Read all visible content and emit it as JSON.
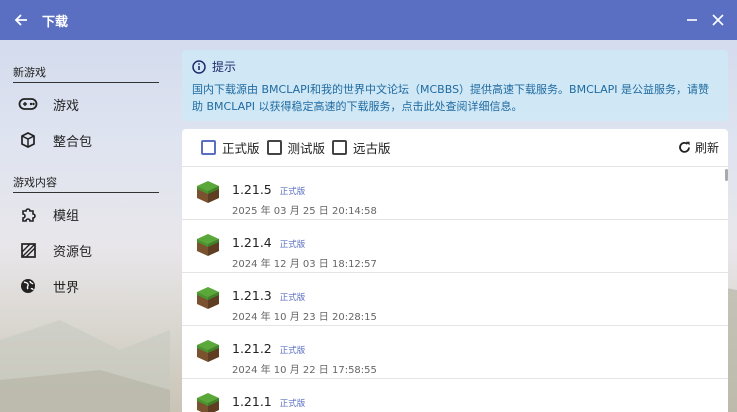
{
  "window": {
    "title": "下载",
    "back_icon": "back-arrow-icon",
    "minimize_icon": "minimize-icon",
    "close_icon": "close-icon"
  },
  "sidebar": {
    "sections": [
      {
        "heading": "新游戏",
        "items": [
          {
            "label": "游戏",
            "icon": "gamepad-icon"
          },
          {
            "label": "整合包",
            "icon": "package-icon"
          }
        ]
      },
      {
        "heading": "游戏内容",
        "items": [
          {
            "label": "模组",
            "icon": "puzzle-icon"
          },
          {
            "label": "资源包",
            "icon": "texture-icon"
          },
          {
            "label": "世界",
            "icon": "globe-icon"
          }
        ]
      }
    ]
  },
  "hint": {
    "icon": "info-icon",
    "title": "提示",
    "text": "国内下载源由 BMCLAPI和我的世界中文论坛（MCBBS）提供高速下载服务。BMCLAPI 是公益服务，请赞助 BMCLAPI 以获得稳定高速的下载服务，点击此处查阅详细信息。"
  },
  "filters": {
    "options": [
      {
        "label": "正式版",
        "checked": false
      },
      {
        "label": "测试版",
        "checked": false
      },
      {
        "label": "远古版",
        "checked": false
      }
    ],
    "refresh_label": "刷新",
    "refresh_icon": "refresh-icon"
  },
  "versions": [
    {
      "version": "1.21.5",
      "type": "正式版",
      "date": "2025 年 03 月 25 日 20:14:58",
      "icon": "grass-block-icon"
    },
    {
      "version": "1.21.4",
      "type": "正式版",
      "date": "2024 年 12 月 03 日 18:12:57",
      "icon": "grass-block-icon"
    },
    {
      "version": "1.21.3",
      "type": "正式版",
      "date": "2024 年 10 月 23 日 20:28:15",
      "icon": "grass-block-icon"
    },
    {
      "version": "1.21.2",
      "type": "正式版",
      "date": "2024 年 10 月 22 日 17:58:55",
      "icon": "grass-block-icon"
    },
    {
      "version": "1.21.1",
      "type": "正式版",
      "date": "",
      "icon": "grass-block-icon"
    }
  ],
  "colors": {
    "accent": "#5b6fc2",
    "hint_bg": "#d0e8f6",
    "hint_text": "#1f6aa0"
  }
}
